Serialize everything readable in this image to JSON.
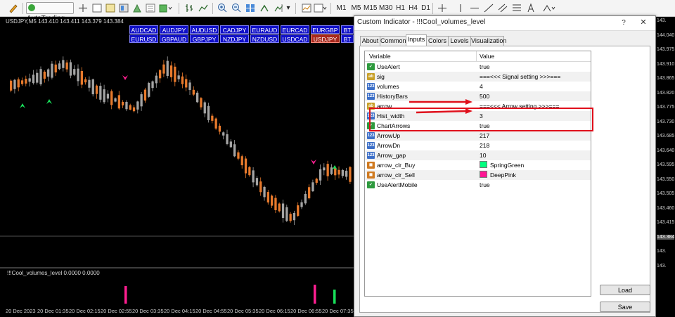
{
  "toolbar": {
    "autotrading_label": "AutoTrading",
    "timeframes": [
      "M1",
      "M5",
      "M15",
      "M30",
      "H1",
      "H4",
      "D1"
    ]
  },
  "chart": {
    "symbol_info": "USDJPY,M5  143.410 143.411 143.379 143.384",
    "subwindow_label": "!!!Cool_volumes_level 0.0000 0.0000",
    "pairs_row1": [
      "AUDCAD",
      "AUDJPY",
      "AUDUSD",
      "CADJPY",
      "EURAUD",
      "EURCAD",
      "EURGBP",
      "BT"
    ],
    "pairs_row2": [
      "EURUSD",
      "GBPAUD",
      "GBPJPY",
      "NZDJPY",
      "NZDUSD",
      "USDCAD",
      "USDJPY",
      "BT"
    ],
    "active_pair": "USDJPY",
    "time_labels": [
      "20 Dec 2023",
      "20 Dec 01:35",
      "20 Dec 02:15",
      "20 Dec 02:55",
      "20 Dec 03:35",
      "20 Dec 04:15",
      "20 Dec 04:55",
      "20 Dec 05:35",
      "20 Dec 06:15",
      "20 Dec 06:55",
      "20 Dec 07:35"
    ],
    "price_labels": [
      "143.",
      "144.040",
      "143.975",
      "143.910",
      "143.865",
      "143.820",
      "143.775",
      "143.730",
      "143.685",
      "143.640",
      "143.595",
      "143.550",
      "143.505",
      "143.460",
      "143.415",
      "143.384",
      "143.",
      "143."
    ],
    "colors": {
      "bull": "#e87a2c",
      "bear": "#a4a4a4",
      "up_arrow": "#18e05a",
      "down_arrow": "#ff1e90"
    }
  },
  "dialog": {
    "title": "Custom Indicator - !!!Cool_volumes_level",
    "help": "?",
    "close": "✕",
    "tabs": [
      "About",
      "Common",
      "Inputs",
      "Colors",
      "Levels",
      "Visualization"
    ],
    "active_tab": "Inputs",
    "columns": {
      "variable": "Variable",
      "value": "Value"
    },
    "rows": [
      {
        "icon": "bool",
        "name": "UseAlert",
        "value": "true"
      },
      {
        "icon": "str",
        "name": "sig",
        "value": "===<<< Signal setting >>>==="
      },
      {
        "icon": "int",
        "name": "volumes",
        "value": "4"
      },
      {
        "icon": "int",
        "name": "HistoryBars",
        "value": "500"
      },
      {
        "icon": "str",
        "name": "arrow",
        "value": "===<<< Arrow setting >>>==="
      },
      {
        "icon": "int",
        "name": "Hist_width",
        "value": "3"
      },
      {
        "icon": "bool",
        "name": "ChartArrows",
        "value": "true"
      },
      {
        "icon": "int",
        "name": "ArrowUp",
        "value": "217"
      },
      {
        "icon": "int",
        "name": "ArrowDn",
        "value": "218"
      },
      {
        "icon": "int",
        "name": "Arrow_gap",
        "value": "10"
      },
      {
        "icon": "color",
        "name": "arrow_clr_Buy",
        "value": "SpringGreen",
        "swatch": "#00ff7f"
      },
      {
        "icon": "color",
        "name": "arrow_clr_Sell",
        "value": "DeepPink",
        "swatch": "#ff1493"
      },
      {
        "icon": "bool",
        "name": "UseAlertMobile",
        "value": "true"
      }
    ],
    "load_label": "Load",
    "save_label": "Save"
  }
}
